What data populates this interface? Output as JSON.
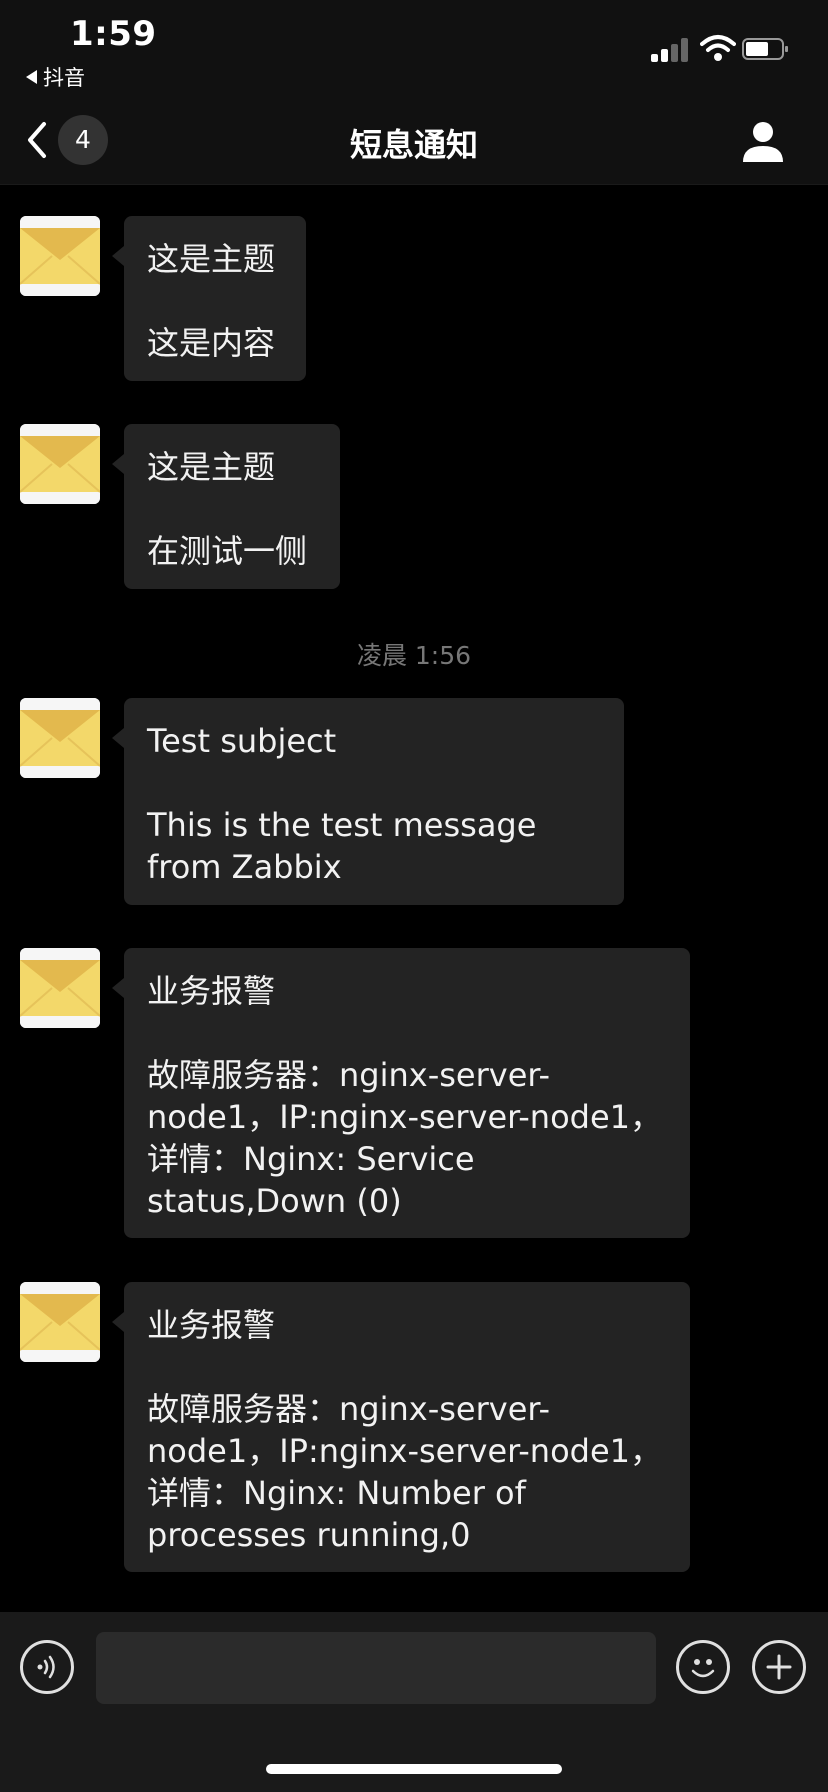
{
  "status_bar": {
    "time": "1:59",
    "back_app": "抖音"
  },
  "nav": {
    "badge": "4",
    "title": "短息通知"
  },
  "messages": [
    {
      "subject": "这是主题",
      "body": "这是内容"
    },
    {
      "subject": "这是主题",
      "body": "在测试一侧"
    },
    {
      "subject": "Test subject",
      "body": "This is the test message from Zabbix"
    },
    {
      "subject": "业务报警",
      "body": "故障服务器：nginx-server-node1，IP:nginx-server-node1，详情：Nginx: Service status,Down (0)"
    },
    {
      "subject": "业务报警",
      "body": "故障服务器：nginx-server-node1，IP:nginx-server-node1，详情：Nginx: Number of processes running,0"
    }
  ],
  "timestamp": "凌晨 1:56",
  "input": {
    "value": "",
    "placeholder": ""
  },
  "icons": {
    "back": "chevron-left-icon",
    "profile": "user-icon",
    "avatar": "envelope-icon",
    "voice": "voice-icon",
    "emoji": "emoji-icon",
    "plus": "plus-icon"
  },
  "colors": {
    "background": "#000000",
    "bubble": "#232323",
    "bar": "#111111",
    "envelope": "#f3d86a"
  }
}
